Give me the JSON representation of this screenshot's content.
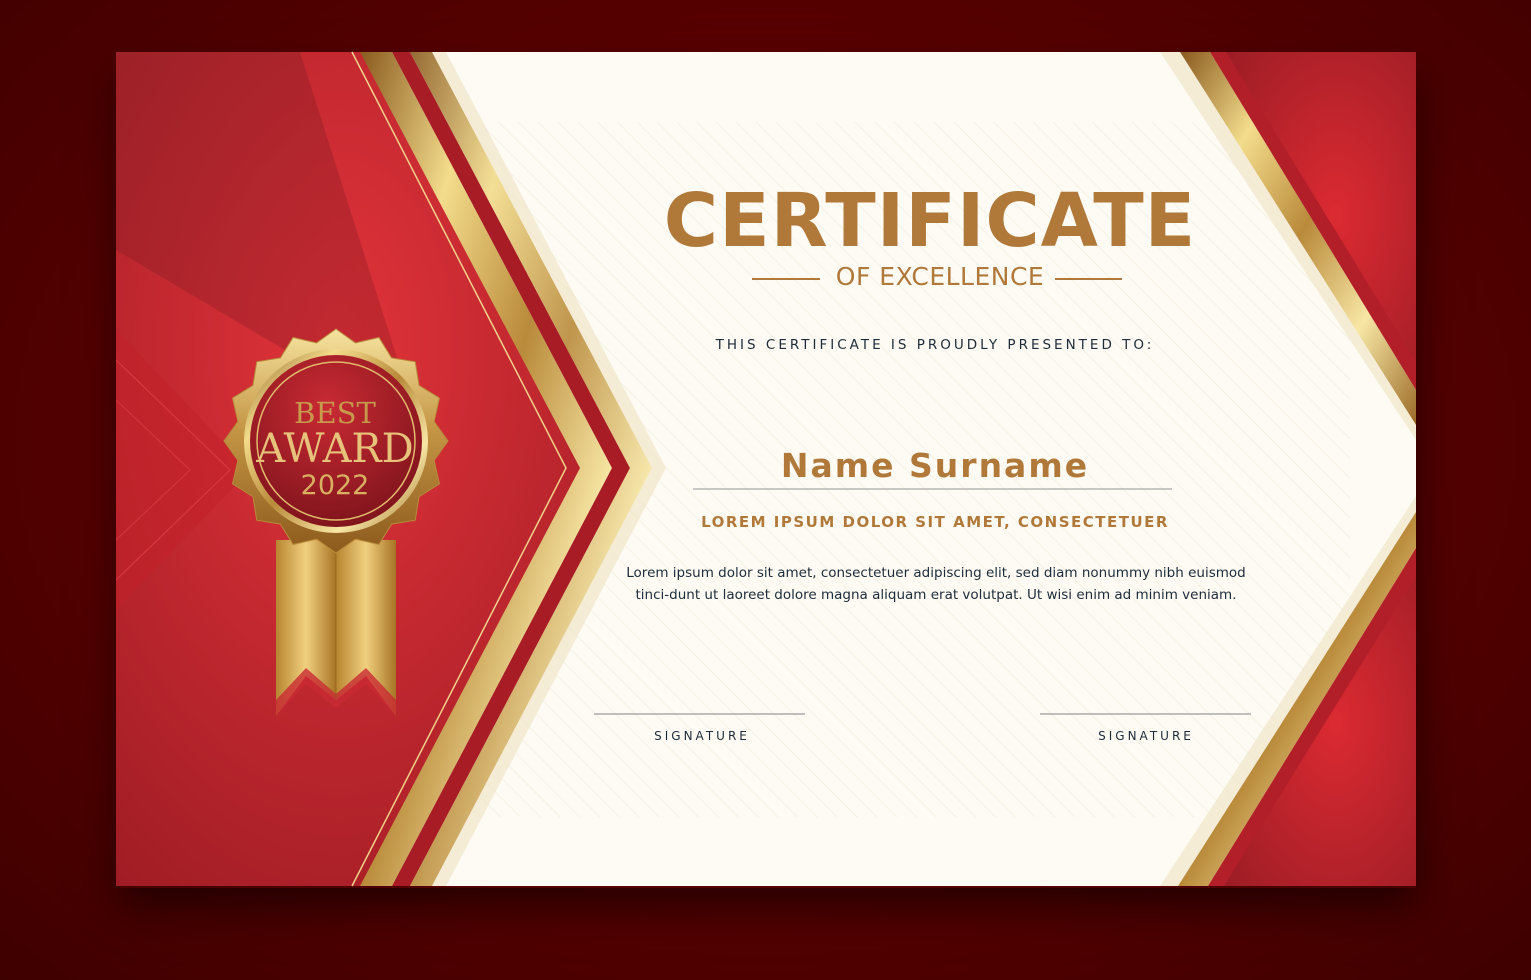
{
  "certificate": {
    "title": "CERTIFICATE",
    "subtitle": "OF EXCELLENCE",
    "presented_to": "THIS CERTIFICATE IS PROUDLY PRESENTED TO:",
    "recipient_name": "Name Surname",
    "heading": "LOREM IPSUM DOLOR SIT AMET, CONSECTETUER",
    "body": "Lorem ipsum dolor sit amet, consectetuer adipiscing elit, sed diam nonummy nibh euismod tinci-dunt ut laoreet dolore magna aliquam erat volutpat. Ut wisi enim ad minim veniam.",
    "signatures": [
      {
        "label": "SIGNATURE"
      },
      {
        "label": "SIGNATURE"
      }
    ]
  },
  "seal": {
    "line1": "BEST",
    "line2": "AWARD",
    "line3": "2022"
  },
  "colors": {
    "background": "#560000",
    "red": "#d1262e",
    "dark_red": "#8e1a22",
    "gold": "#b0793a",
    "navy_text": "#1d2b3a",
    "paper": "#fdfbf3"
  },
  "icons": {
    "seal": "award-ribbon-icon"
  }
}
